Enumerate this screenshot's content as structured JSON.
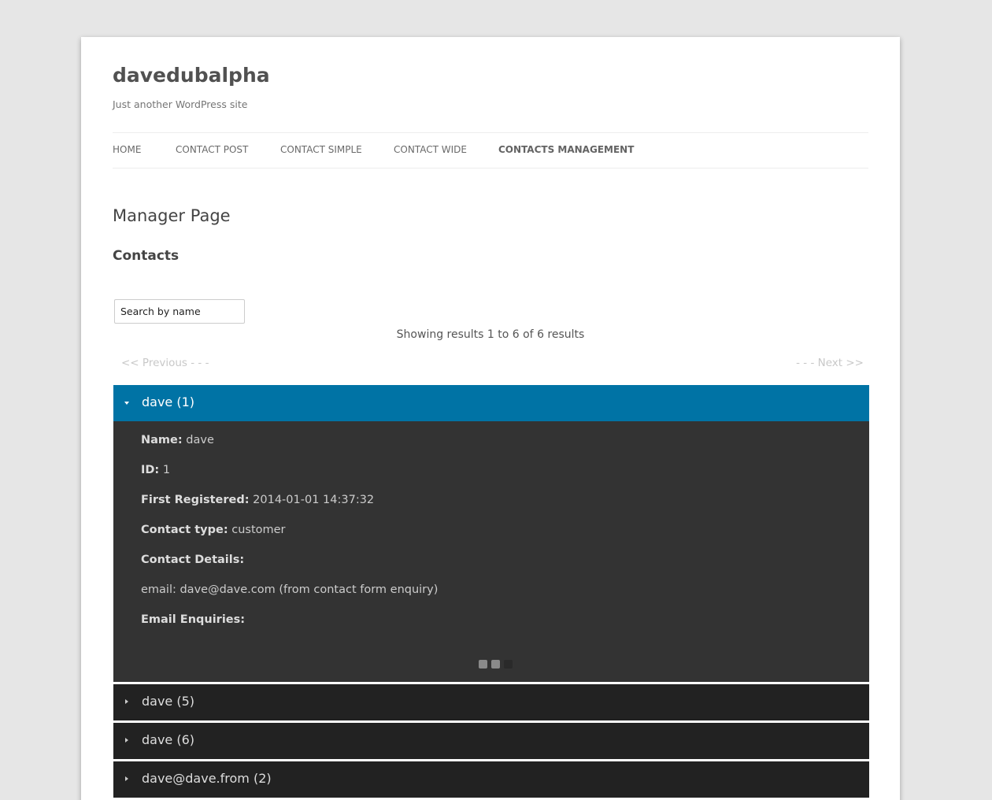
{
  "site": {
    "title": "davedubalpha",
    "description": "Just another WordPress site"
  },
  "nav": {
    "items": [
      {
        "label": "HOME"
      },
      {
        "label": "CONTACT POST"
      },
      {
        "label": "CONTACT SIMPLE"
      },
      {
        "label": "CONTACT WIDE"
      },
      {
        "label": "CONTACTS MANAGEMENT"
      }
    ],
    "current": "CONTACTS MANAGEMENT"
  },
  "main": {
    "page_title": "Manager Page",
    "section_title": "Contacts",
    "search_placeholder": "Search by name",
    "results_text": "Showing results 1 to 6 of 6 results",
    "prev_label": "<< Previous - - -",
    "next_label": "- - - Next >>"
  },
  "contacts": [
    {
      "title": "dave (1)",
      "expanded": true,
      "name_label": "Name:",
      "name": " dave",
      "id_label": "ID:",
      "id": " 1",
      "registered_label": "First Registered:",
      "registered": " 2014-01-01 14:37:32",
      "type_label": "Contact type:",
      "type": " customer",
      "details_label": "Contact Details:",
      "email_line": "email: dave@dave.com (from contact form enquiry)",
      "enquiries_label": "Email Enquiries:"
    },
    {
      "title": "dave (5)",
      "expanded": false
    },
    {
      "title": "dave (6)",
      "expanded": false
    },
    {
      "title": "dave@dave.from (2)",
      "expanded": false
    }
  ],
  "colors": {
    "active_header": "#0073a5",
    "collapsed_header": "#222222",
    "body_bg": "#333333"
  },
  "icons": {
    "expanded": "caret-down-icon",
    "collapsed": "caret-right-icon"
  }
}
